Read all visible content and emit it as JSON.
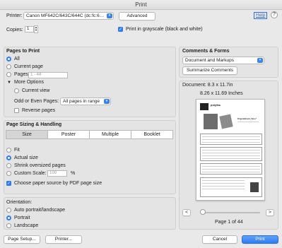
{
  "window": {
    "title": "Print"
  },
  "printer": {
    "label": "Printer:",
    "value": "Canon MF642C/643C/644C (dc:fc:6…",
    "advanced": "Advanced",
    "help": "Help"
  },
  "copies": {
    "label": "Copies:",
    "value": "1"
  },
  "grayscale": {
    "label": "Print in grayscale (black and white)",
    "checked": true
  },
  "pages": {
    "heading": "Pages to Print",
    "all": "All",
    "current": "Current page",
    "pages_label": "Pages",
    "pages_placeholder": "1 - 44",
    "more_options": "More Options",
    "current_view": "Current view",
    "odd_even_label": "Odd or Even Pages:",
    "odd_even_value": "All pages in range",
    "reverse": "Reverse pages"
  },
  "sizing": {
    "heading": "Page Sizing & Handling",
    "tabs": [
      "Size",
      "Poster",
      "Multiple",
      "Booklet"
    ],
    "fit": "Fit",
    "actual": "Actual size",
    "shrink": "Shrink oversized pages",
    "custom": "Custom Scale:",
    "custom_value": "100",
    "percent": "%",
    "paper_source": "Choose paper source by PDF page size"
  },
  "orientation": {
    "heading": "Orientation:",
    "auto": "Auto portrait/landscape",
    "portrait": "Portrait",
    "landscape": "Landscape"
  },
  "comments": {
    "heading": "Comments & Forms",
    "value": "Document and Markups",
    "summarize": "Summarize Comments"
  },
  "preview": {
    "document": "Document: 8.3 x 11.7in",
    "size": "8.26 x 11.69 Inches",
    "page_label": "Page 1 of 44",
    "prev": "<",
    "next": ">",
    "doc_logo": "polyfas",
    "doc_heading": "Fingerabdruck „Fluss“"
  },
  "footer": {
    "page_setup": "Page Setup...",
    "printer": "Printer...",
    "cancel": "Cancel",
    "print": "Print"
  }
}
